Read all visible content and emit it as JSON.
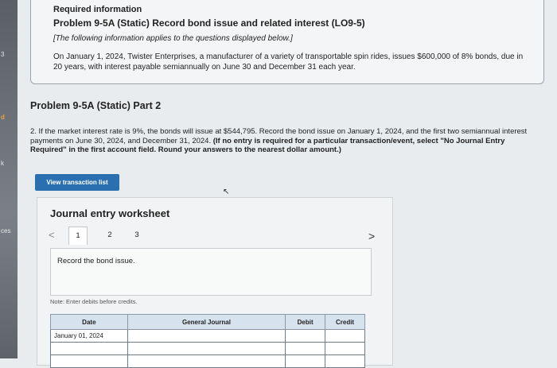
{
  "sidebar": {
    "labels": [
      "3",
      "d",
      "k",
      "ces"
    ]
  },
  "info": {
    "required_label": "Required information",
    "problem_title": "Problem 9-5A (Static) Record bond issue and related interest (LO9-5)",
    "note": "[The following information applies to the questions displayed below.]",
    "description": "On January 1, 2024, Twister Enterprises, a manufacturer of a variety of transportable spin rides, issues $600,000 of 8% bonds, due in 20 years, with interest payable semiannually on June 30 and December 31 each year."
  },
  "part": {
    "title": "Problem 9-5A (Static) Part 2"
  },
  "question": {
    "text": "2. If the market interest rate is 9%, the bonds will issue at $544,795. Record the bond issue on January 1, 2024, and the first two semiannual interest payments on June 30, 2024, and December 31, 2024. ",
    "bold_text": "(If no entry is required for a particular transaction/event, select \"No Journal Entry Required\" in the first account field. Round your answers to the nearest dollar amount.)"
  },
  "buttons": {
    "view_transaction_list": "View transaction list"
  },
  "worksheet": {
    "title": "Journal entry worksheet",
    "prev": "<",
    "next": ">",
    "tabs": [
      "1",
      "2",
      "3"
    ],
    "active_tab": "1",
    "record_text": "Record the bond issue.",
    "note": "Note: Enter debits before credits.",
    "table": {
      "headers": {
        "date": "Date",
        "general_journal": "General Journal",
        "debit": "Debit",
        "credit": "Credit"
      },
      "rows": [
        {
          "date": "January 01, 2024",
          "account": "",
          "debit": "",
          "credit": ""
        },
        {
          "date": "",
          "account": "",
          "debit": "",
          "credit": ""
        },
        {
          "date": "",
          "account": "",
          "debit": "",
          "credit": ""
        }
      ]
    }
  },
  "colors": {
    "button": "#2a6fb0",
    "table_header": "#d7e2ef"
  }
}
